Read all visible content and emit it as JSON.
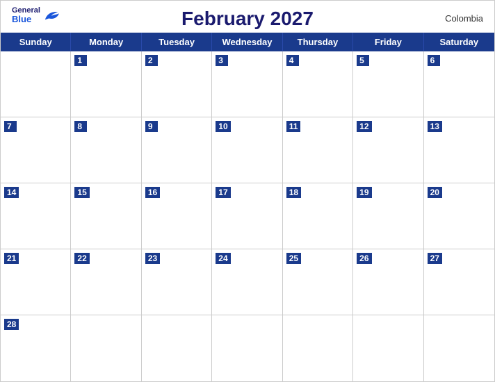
{
  "header": {
    "logo": {
      "general": "General",
      "blue": "Blue",
      "bird_color": "#1a56db"
    },
    "title": "February 2027",
    "country": "Colombia"
  },
  "days": [
    "Sunday",
    "Monday",
    "Tuesday",
    "Wednesday",
    "Thursday",
    "Friday",
    "Saturday"
  ],
  "weeks": [
    [
      null,
      1,
      2,
      3,
      4,
      5,
      6
    ],
    [
      7,
      8,
      9,
      10,
      11,
      12,
      13
    ],
    [
      14,
      15,
      16,
      17,
      18,
      19,
      20
    ],
    [
      21,
      22,
      23,
      24,
      25,
      26,
      27
    ],
    [
      28,
      null,
      null,
      null,
      null,
      null,
      null
    ]
  ],
  "colors": {
    "header_bg": "#1a3a8c",
    "title_color": "#1a1a6e",
    "date_num_bg": "#1a3a8c",
    "border": "#ccc"
  }
}
